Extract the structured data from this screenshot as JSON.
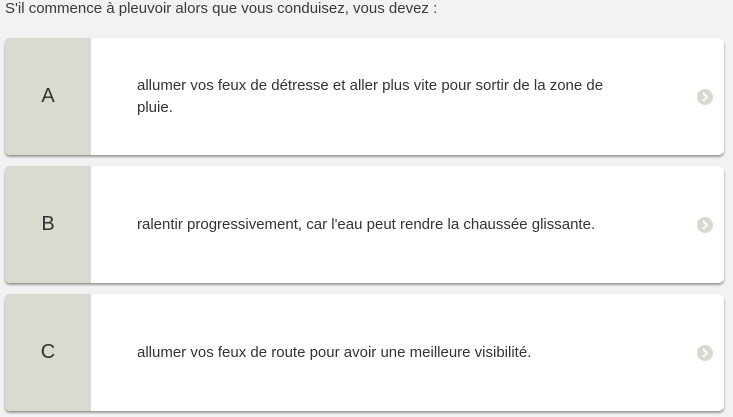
{
  "question": "S'il commence à pleuvoir alors que vous conduisez, vous devez :",
  "options": [
    {
      "letter": "A",
      "text": "allumer vos feux de détresse et aller plus vite pour sortir de la zone de pluie."
    },
    {
      "letter": "B",
      "text": "ralentir progressivement, car l'eau peut rendre la chaussée glissante."
    },
    {
      "letter": "C",
      "text": "allumer vos feux de route pour avoir une meilleure visibilité."
    }
  ],
  "icons": {
    "option_arrow": "chevron-right-icon"
  },
  "colors": {
    "letter_panel": "#d9dad0",
    "card": "#ffffff",
    "chevron": "#d8d8d0"
  }
}
